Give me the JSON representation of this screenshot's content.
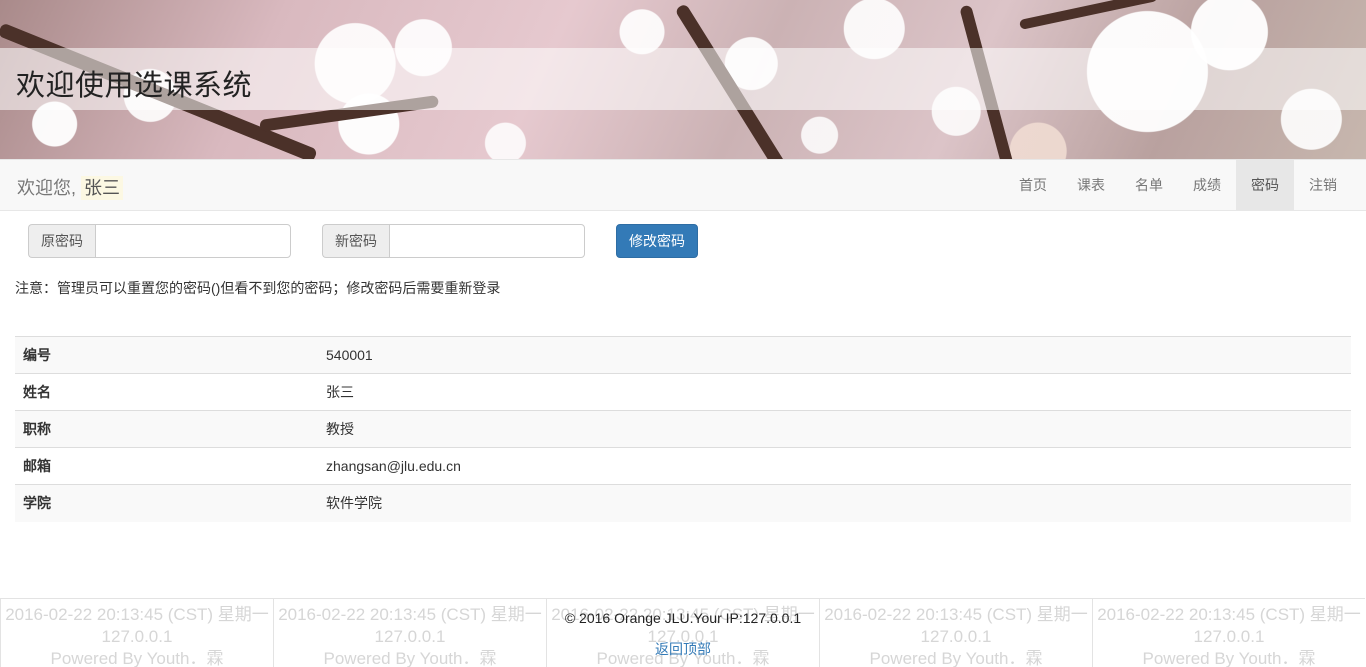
{
  "header": {
    "title": "欢迎使用选课系统"
  },
  "navbar": {
    "welcome_prefix": "欢迎您,",
    "username": "张三",
    "links": [
      {
        "label": "首页",
        "active": false
      },
      {
        "label": "课表",
        "active": false
      },
      {
        "label": "名单",
        "active": false
      },
      {
        "label": "成绩",
        "active": false
      },
      {
        "label": "密码",
        "active": true
      },
      {
        "label": "注销",
        "active": false
      }
    ]
  },
  "form": {
    "old_password_label": "原密码",
    "old_password_value": "",
    "new_password_label": "新密码",
    "new_password_value": "",
    "submit_label": "修改密码",
    "note": "注意：管理员可以重置您的密码()但看不到您的密码；修改密码后需要重新登录"
  },
  "profile": {
    "rows": [
      {
        "key": "编号",
        "value": "540001"
      },
      {
        "key": "姓名",
        "value": "张三"
      },
      {
        "key": "职称",
        "value": "教授"
      },
      {
        "key": "邮箱",
        "value": "zhangsan@jlu.edu.cn"
      },
      {
        "key": "学院",
        "value": "软件学院"
      }
    ]
  },
  "footer": {
    "back_to_top": "返回顶部",
    "copyright": "© 2016 Orange JLU.Your IP:127.0.0.1",
    "watermark": {
      "line1": "2016-02-22 20:13:45 (CST) 星期一",
      "line2": "127.0.0.1",
      "line3": "Powered By Youth．霖"
    }
  },
  "colors": {
    "primary": "#337ab7",
    "nav_active_bg": "#e7e7e7",
    "username_highlight": "#fcf8e3"
  }
}
